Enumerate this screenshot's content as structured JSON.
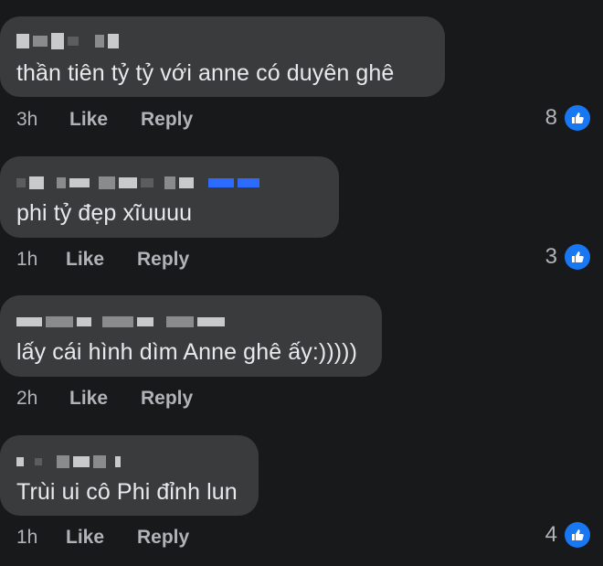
{
  "comments": [
    {
      "text": "thần tiên tỷ tỷ với anne có duyên ghê",
      "time": "3h",
      "like_label": "Like",
      "reply_label": "Reply",
      "reaction_count": "8"
    },
    {
      "text": "phi tỷ đẹp xĩuuuu",
      "time": "1h",
      "like_label": "Like",
      "reply_label": "Reply",
      "reaction_count": "3"
    },
    {
      "text": "lấy cái hình dìm Anne ghê ấy:)))))",
      "time": "2h",
      "like_label": "Like",
      "reply_label": "Reply",
      "reaction_count": ""
    },
    {
      "text": "Trùi ui cô Phi đỉnh lun",
      "time": "1h",
      "like_label": "Like",
      "reply_label": "Reply",
      "reaction_count": "4"
    }
  ],
  "colors": {
    "background": "#18191a",
    "bubble": "#3a3b3c",
    "like_icon": "#1877f2"
  }
}
